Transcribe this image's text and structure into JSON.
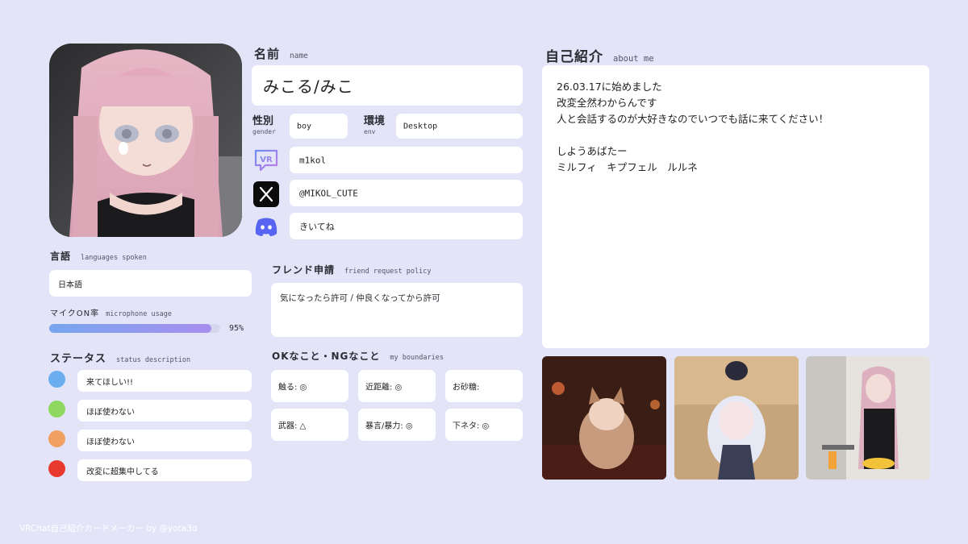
{
  "profile": {
    "name_title_jp": "名前",
    "name_title_en": "name",
    "name_value": "みこる/みこ",
    "gender_label_jp": "性別",
    "gender_label_en": "gender",
    "gender_value": "boy",
    "env_label_jp": "環境",
    "env_label_en": "env",
    "env_value": "Desktop",
    "vrchat_id": "m1kol",
    "x_handle": "@MIKOL_CUTE",
    "discord_value": "きいてね"
  },
  "languages": {
    "title_jp": "言語",
    "title_en": "languages spoken",
    "value": "日本語"
  },
  "mic": {
    "title_jp": "マイクON率",
    "title_en": "microphone usage",
    "percent_label": "95%",
    "fraction": 0.95
  },
  "status": {
    "title_jp": "ステータス",
    "title_en": "status description",
    "items": [
      {
        "color": "#6aaef0",
        "label": "来てほしい!!"
      },
      {
        "color": "#8fd860",
        "label": "ほぼ使わない"
      },
      {
        "color": "#f0a060",
        "label": "ほぼ使わない"
      },
      {
        "color": "#e8392f",
        "label": "改変に超集中してる"
      }
    ]
  },
  "friend": {
    "title_jp": "フレンド申請",
    "title_en": "friend request policy",
    "value": "気になったら許可 / 仲良くなってから許可"
  },
  "boundaries": {
    "title_jp": "OKなこと・NGなこと",
    "title_en": "my boundaries",
    "items": [
      {
        "label": "触る: ◎"
      },
      {
        "label": "近距離: ◎"
      },
      {
        "label": "お砂糖:"
      },
      {
        "label": "武器: △"
      },
      {
        "label": "暴言/暴力: ◎"
      },
      {
        "label": "下ネタ: ◎"
      }
    ]
  },
  "about": {
    "title_jp": "自己紹介",
    "title_en": "about me",
    "text": "26.03.17に始めました\n改変全然わからんです\n人と会話するのが大好きなのでいつでも話に来てください！\n\nしようあばたー\nミルフィ　キプフェル　ルルネ"
  },
  "icons": {
    "vrchat": "vrchat-icon",
    "x": "x-logo-icon",
    "discord": "discord-icon"
  },
  "footer": "VRChat自己紹介カードメーカー by @yota3d"
}
